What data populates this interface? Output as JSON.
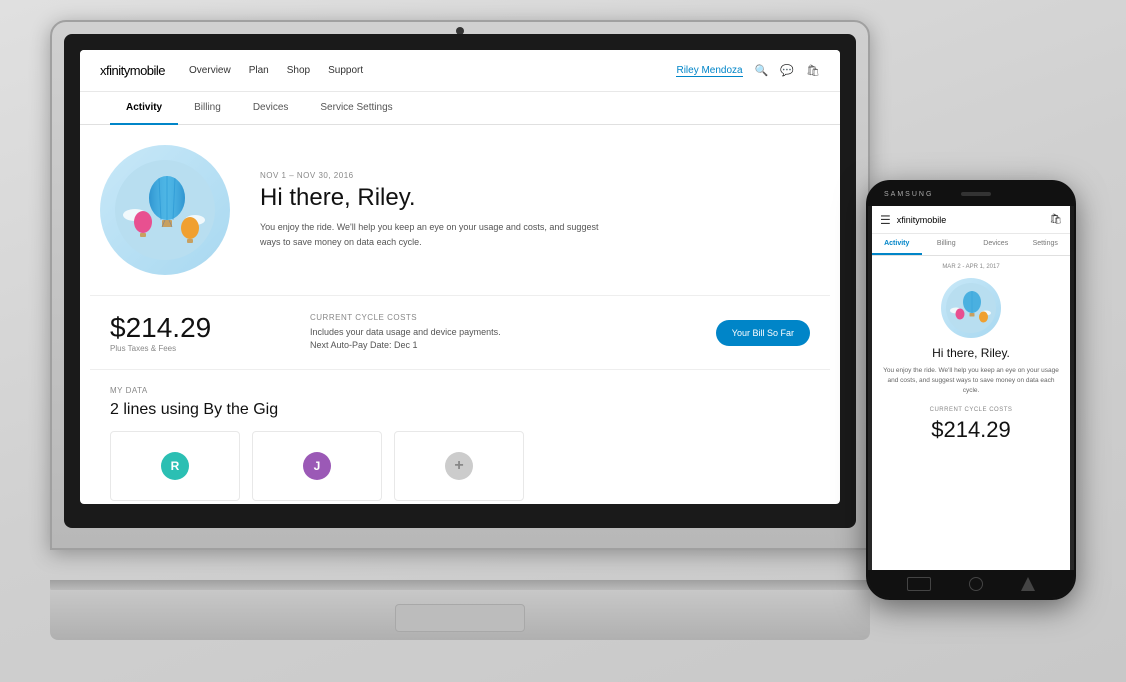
{
  "scene": {
    "background": "#d8d8d8"
  },
  "laptop": {
    "nav": {
      "logo": "xfinity",
      "logo_mobile": "mobile",
      "links": [
        "Overview",
        "Plan",
        "Shop",
        "Support"
      ],
      "user": "Riley Mendoza",
      "icons": [
        "search",
        "chat",
        "cart"
      ]
    },
    "tabs": [
      {
        "label": "Activity",
        "active": true
      },
      {
        "label": "Billing",
        "active": false
      },
      {
        "label": "Devices",
        "active": false
      },
      {
        "label": "Service Settings",
        "active": false
      }
    ],
    "hero": {
      "date_range": "NOV 1 – NOV 30, 2016",
      "title": "Hi there, Riley.",
      "description": "You enjoy the ride. We'll help you keep an eye on your usage and costs, and suggest ways to save money on data each cycle."
    },
    "billing": {
      "price": "$214.29",
      "sub_label": "Plus Taxes & Fees",
      "section_label": "CURRENT CYCLE COSTS",
      "detail_line1": "Includes your data usage and device payments.",
      "detail_line2": "Next Auto-Pay Date: Dec 1",
      "button_label": "Your Bill So Far"
    },
    "data": {
      "section_label": "MY DATA",
      "title": "2 lines using By the Gig",
      "lines": [
        {
          "initial": "R",
          "color": "#2bbfb3"
        },
        {
          "initial": "J",
          "color": "#9b59b6"
        }
      ]
    }
  },
  "phone": {
    "brand": "SAMSUNG",
    "nav": {
      "logo": "xfinity",
      "logo_mobile": "mobile"
    },
    "tabs": [
      {
        "label": "Activity",
        "active": true
      },
      {
        "label": "Billing",
        "active": false
      },
      {
        "label": "Devices",
        "active": false
      },
      {
        "label": "Settings",
        "active": false
      }
    ],
    "hero": {
      "date_range": "MAR 2 - APR 1, 2017",
      "title": "Hi there, Riley.",
      "description": "You enjoy the ride. We'll help you keep an eye on your usage and costs, and suggest ways to save money on data each cycle."
    },
    "billing": {
      "section_label": "CURRENT CYCLE COSTS",
      "price": "$214.29"
    }
  }
}
